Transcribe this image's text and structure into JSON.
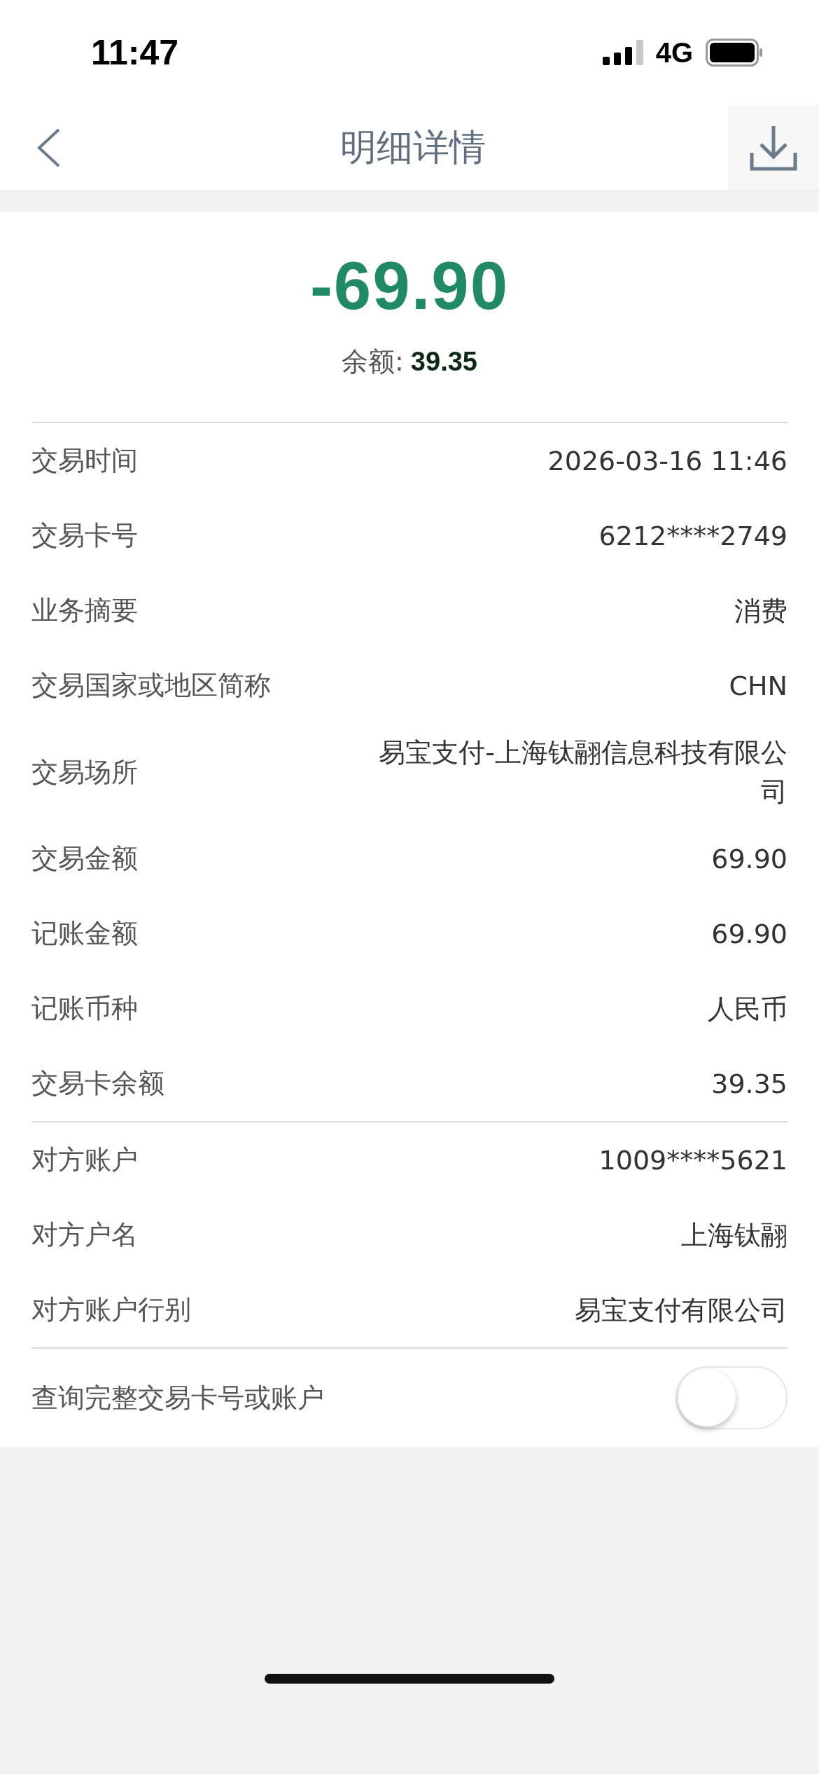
{
  "status_bar": {
    "time": "11:47",
    "network": "4G"
  },
  "nav": {
    "title": "明细详情"
  },
  "summary": {
    "amount": "-69.90",
    "balance_label": "余额:",
    "balance": "39.35"
  },
  "sections": [
    {
      "rows": [
        {
          "label": "交易时间",
          "value": "2026-03-16 11:46"
        },
        {
          "label": "交易卡号",
          "value": "6212****2749"
        },
        {
          "label": "业务摘要",
          "value": "消费"
        },
        {
          "label": "交易国家或地区简称",
          "value": "CHN"
        },
        {
          "label": "交易场所",
          "value": "易宝支付-上海钛翮信息科技有限公司"
        },
        {
          "label": "交易金额",
          "value": "69.90"
        },
        {
          "label": "记账金额",
          "value": "69.90"
        },
        {
          "label": "记账币种",
          "value": "人民币"
        },
        {
          "label": "交易卡余额",
          "value": "39.35"
        }
      ]
    },
    {
      "rows": [
        {
          "label": "对方账户",
          "value": "1009****5621"
        },
        {
          "label": "对方户名",
          "value": "上海钛翮"
        },
        {
          "label": "对方账户行别",
          "value": "易宝支付有限公司"
        }
      ]
    }
  ],
  "toggle_row": {
    "label": "查询完整交易卡号或账户",
    "on": false
  }
}
